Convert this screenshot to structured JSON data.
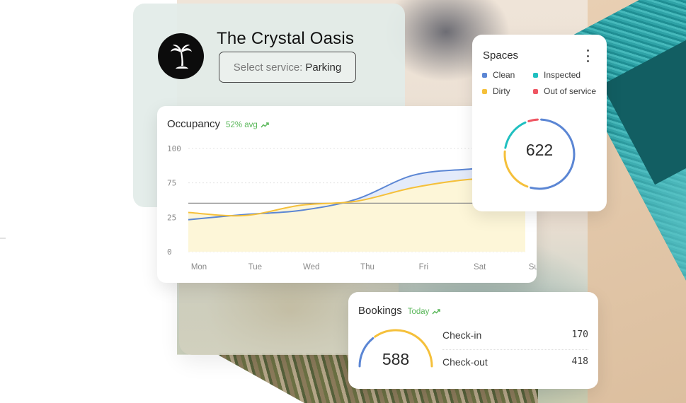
{
  "hotel": {
    "name": "The Crystal Oasis",
    "logo_icon": "palm-tree-icon",
    "service_select": {
      "label": "Select service:",
      "value": "Parking"
    }
  },
  "occupancy": {
    "title": "Occupancy",
    "trend_text": "52% avg",
    "trend_icon": "trending-up-icon"
  },
  "spaces": {
    "title": "Spaces",
    "menu_icon": "kebab-menu-icon",
    "total": "622",
    "legend": [
      {
        "label": "Clean",
        "color": "#5b86d4"
      },
      {
        "label": "Inspected",
        "color": "#1fbfc0"
      },
      {
        "label": "Dirty",
        "color": "#f5c03a"
      },
      {
        "label": "Out of service",
        "color": "#ef5562"
      }
    ]
  },
  "bookings": {
    "title": "Bookings",
    "trend_text": "Today",
    "trend_icon": "trending-up-icon",
    "total": "588",
    "rows": [
      {
        "label": "Check-in",
        "value": "170"
      },
      {
        "label": "Check-out",
        "value": "418"
      }
    ]
  },
  "colors": {
    "accent_blue": "#5b86d4",
    "accent_yellow": "#f5c03a",
    "accent_teal": "#1fbfc0",
    "accent_red": "#ef5562",
    "trend_green": "#5cb85c"
  },
  "chart_data": [
    {
      "type": "area",
      "title": "Occupancy",
      "subtitle": "52% avg",
      "xlabel": "",
      "ylabel": "",
      "categories": [
        "Mon",
        "Tue",
        "Wed",
        "Thu",
        "Fri",
        "Sat",
        "Sun"
      ],
      "y_ticks": [
        "0",
        "25",
        "75",
        "100"
      ],
      "ylim": [
        0,
        100
      ],
      "grid": true,
      "reference_line": 47,
      "series": [
        {
          "name": "Blue series",
          "color": "#5b86d4",
          "values": [
            31,
            36,
            40,
            51,
            74,
            80,
            83
          ]
        },
        {
          "name": "Yellow series",
          "color": "#f5c03a",
          "values": [
            38,
            35,
            45,
            49,
            62,
            70,
            72
          ]
        }
      ]
    },
    {
      "type": "pie",
      "title": "Spaces",
      "center_label": "622",
      "categories": [
        "Clean",
        "Dirty",
        "Inspected",
        "Out of service"
      ],
      "values": [
        57,
        22,
        16.5,
        4.5
      ],
      "colors": [
        "#5b86d4",
        "#f5c03a",
        "#1fbfc0",
        "#ef5562"
      ]
    },
    {
      "type": "pie",
      "title": "Bookings",
      "center_label": "588",
      "categories": [
        "Check-in",
        "Check-out"
      ],
      "values": [
        170,
        418
      ],
      "colors": [
        "#5b86d4",
        "#f5c03a"
      ]
    }
  ]
}
